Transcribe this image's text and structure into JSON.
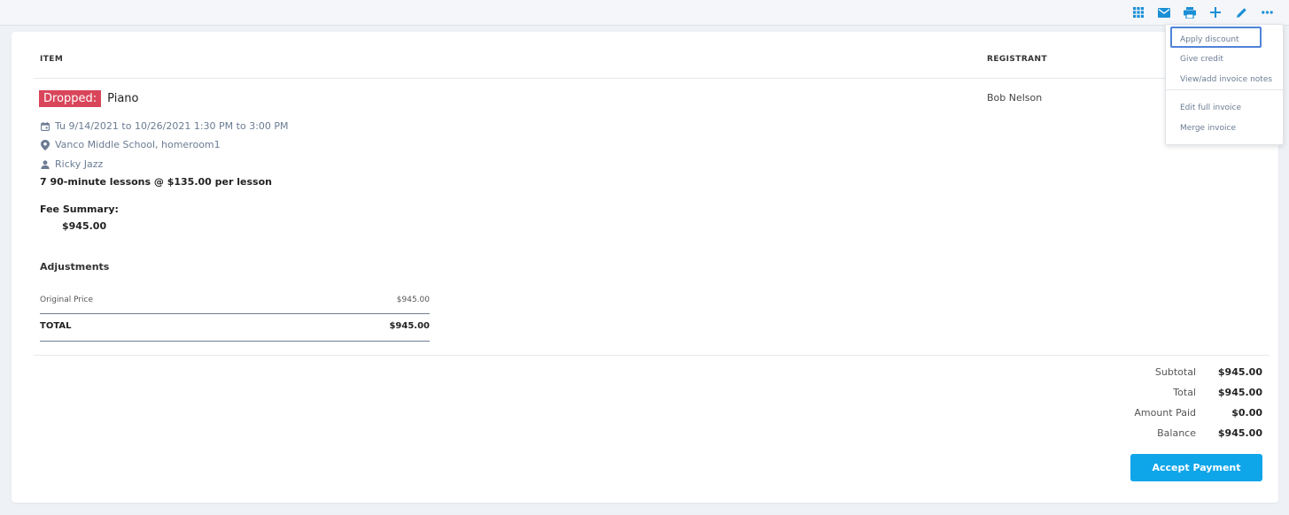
{
  "toolbar": {
    "icons": [
      "grid-icon",
      "mail-icon",
      "print-icon",
      "plus-icon",
      "pencil-icon",
      "more-icon"
    ],
    "accent_color": "#1a8fd6"
  },
  "table": {
    "col_item": "ITEM",
    "col_registrant": "REGISTRANT"
  },
  "item": {
    "status_badge": "Dropped:",
    "status_color": "#d9455a",
    "name": "Piano",
    "schedule": "Tu 9/14/2021 to 10/26/2021 1:30 PM to 3:00 PM",
    "location": "Vanco Middle School, homeroom1",
    "instructor": "Ricky Jazz",
    "lessons": "7 90-minute lessons @ $135.00 per lesson",
    "fee_summary_label": "Fee Summary:",
    "fee_summary_value": "$945.00",
    "registrant": "Bob Nelson"
  },
  "adjustments": {
    "title": "Adjustments",
    "original_label": "Original Price",
    "original_value": "$945.00",
    "total_label": "TOTAL",
    "total_value": "$945.00"
  },
  "summary": {
    "subtotal_label": "Subtotal",
    "subtotal_value": "$945.00",
    "total_label": "Total",
    "total_value": "$945.00",
    "paid_label": "Amount Paid",
    "paid_value": "$0.00",
    "balance_label": "Balance",
    "balance_value": "$945.00"
  },
  "accept_payment_label": "Accept Payment",
  "accept_payment_color": "#0ea5e9",
  "menu": {
    "items": [
      "Apply discount",
      "Give credit",
      "View/add invoice notes",
      "Edit full invoice",
      "Merge invoice"
    ],
    "focus_color": "#4f83d9"
  }
}
